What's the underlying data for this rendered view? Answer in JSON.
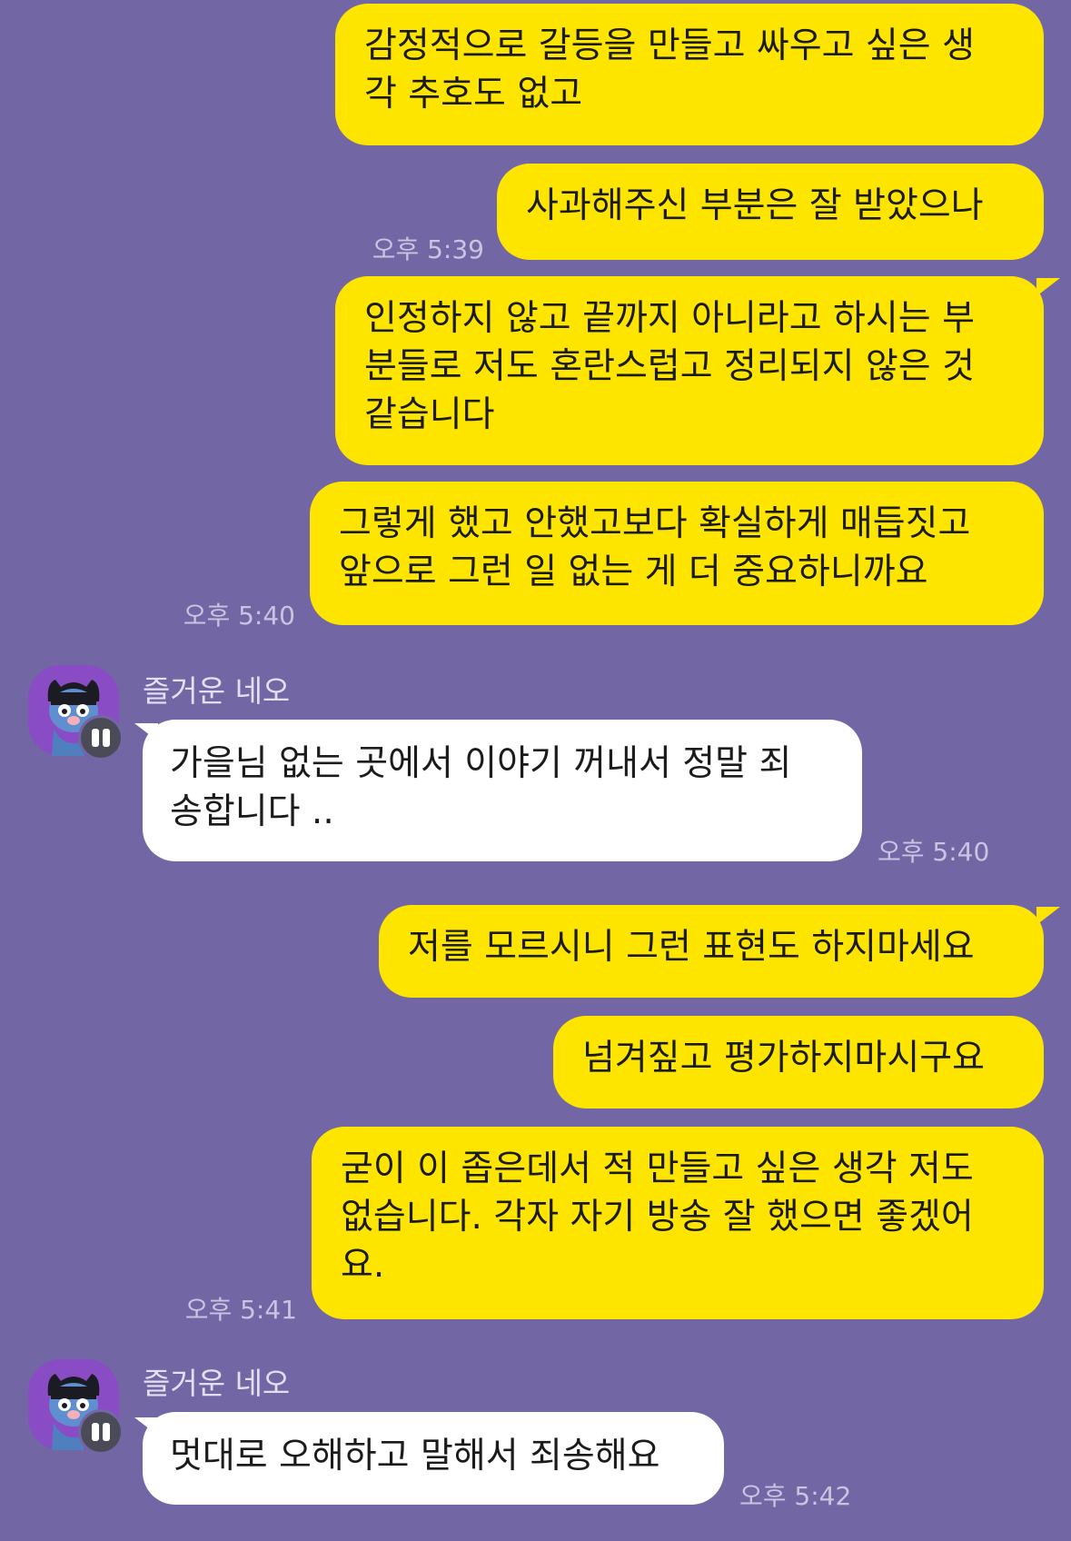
{
  "messages": [
    {
      "side": "mine",
      "text": "감정적으로 갈등을 만들고 싸우고 싶은 생\n각 추호도 없고"
    },
    {
      "side": "mine",
      "text": "사과해주신 부분은 잘 받았으나",
      "time": "오후 5:39"
    },
    {
      "side": "mine",
      "text": "인정하지 않고 끝까지 아니라고 하시는 부\n분들로 저도 혼란스럽고 정리되지 않은 것\n같습니다"
    },
    {
      "side": "mine",
      "text": "그렇게 했고 안했고보다 확실하게 매듭짓고\n앞으로 그런 일 없는 게 더 중요하니까요",
      "time": "오후 5:40"
    },
    {
      "side": "theirs",
      "sender": "즐거운 네오",
      "text": "가을님 없는 곳에서 이야기 꺼내서 정말 죄\n송합니다 ..",
      "time": "오후 5:40"
    },
    {
      "side": "mine",
      "text": "저를 모르시니 그런 표현도 하지마세요"
    },
    {
      "side": "mine",
      "text": "넘겨짚고 평가하지마시구요"
    },
    {
      "side": "mine",
      "text": "굳이 이 좁은데서 적 만들고 싶은 생각 저도\n없습니다. 각자 자기 방송 잘 했으면 좋겠어\n요.",
      "time": "오후 5:41"
    },
    {
      "side": "theirs",
      "sender": "즐거운 네오",
      "text": "멋대로 오해하고 말해서 죄송해요",
      "time": "오후 5:42"
    }
  ],
  "icons": {
    "avatar": "neo-character-avatar",
    "badge": "channel-badge-icon"
  },
  "colors": {
    "background": "#7267a4",
    "my_bubble": "#fee500",
    "their_bubble": "#ffffff"
  }
}
